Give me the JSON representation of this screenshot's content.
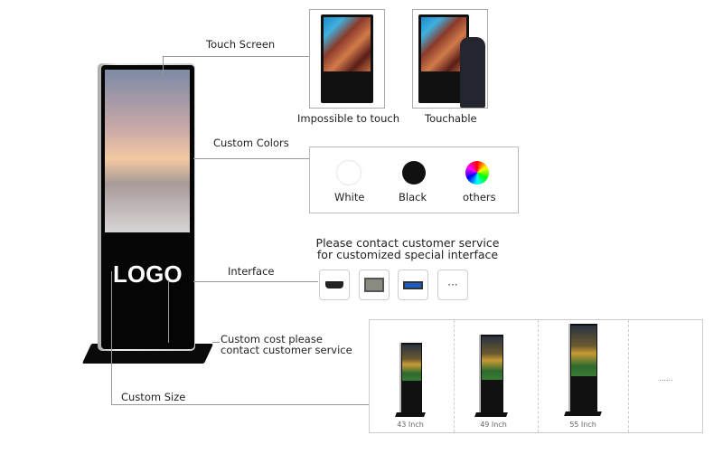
{
  "callouts": {
    "touch_screen": "Touch Screen",
    "custom_colors": "Custom Colors",
    "interface": "Interface",
    "custom_cost_line1": "Custom cost please",
    "custom_cost_line2": "contact customer service",
    "custom_size": "Custom Size"
  },
  "kiosk": {
    "logo_text": "LOGO"
  },
  "touch_options": [
    {
      "label": "Impossible to touch"
    },
    {
      "label": "Touchable"
    }
  ],
  "colors": [
    {
      "label": "White",
      "color": "#ffffff"
    },
    {
      "label": "Black",
      "color": "#111111"
    },
    {
      "label": "others",
      "color": "rainbow"
    }
  ],
  "interface_panel": {
    "line1": "Please contact customer service",
    "line2": "for customized special interface",
    "ports": [
      "hdmi-port-icon",
      "rj45-port-icon",
      "usb-port-icon",
      "more-icon"
    ],
    "more_label": "···"
  },
  "sizes": [
    {
      "label": "43 Inch"
    },
    {
      "label": "49 Inch"
    },
    {
      "label": "55 Inch"
    },
    {
      "label": "......"
    }
  ]
}
